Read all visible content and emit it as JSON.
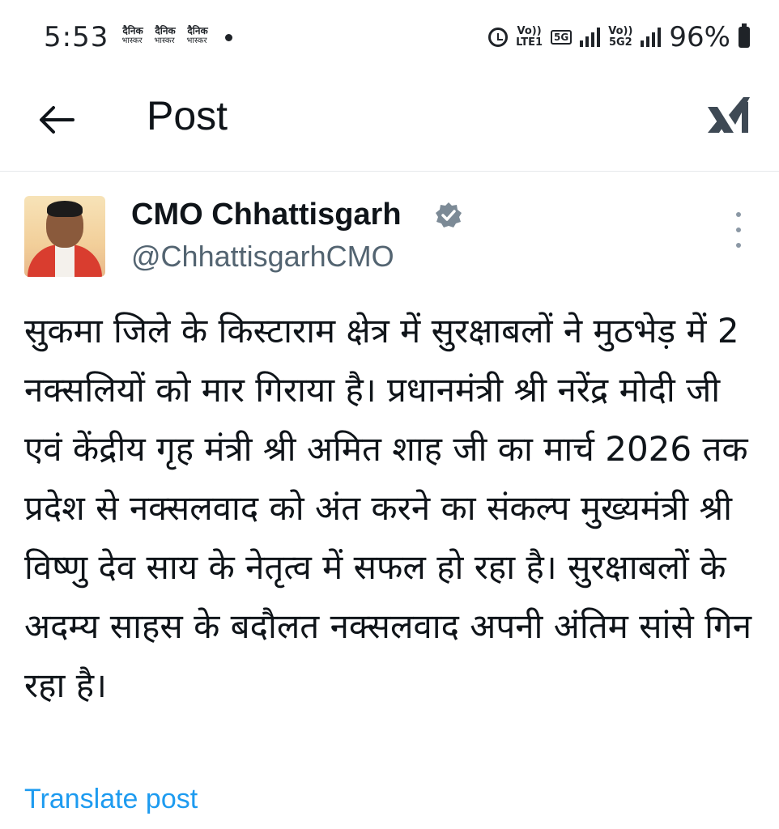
{
  "status_bar": {
    "time": "5:53",
    "notifications": [
      {
        "line1": "दैनिक",
        "line2": "भास्कर"
      },
      {
        "line1": "दैनिक",
        "line2": "भास्कर"
      },
      {
        "line1": "दैनिक",
        "line2": "भास्कर"
      }
    ],
    "sim1": {
      "top": "Vo))",
      "bottom": "LTE1"
    },
    "network_badge": "5G",
    "sim2": {
      "top": "Vo))",
      "bottom": "5G2"
    },
    "battery": "96%"
  },
  "header": {
    "title": "Post",
    "logo": "x-logo"
  },
  "post": {
    "author_name": "CMO Chhattisgarh",
    "handle": "@ChhattisgarhCMO",
    "verified": true,
    "text": "सुकमा जिले के किस्टाराम क्षेत्र में सुरक्षाबलों ने मुठभेड़ में 2 नक्सलियों को मार गिराया है। प्रधानमंत्री श्री नरेंद्र मोदी जी एवं केंद्रीय गृह मंत्री श्री अमित शाह जी का मार्च 2026 तक प्रदेश से नक्सलवाद को अंत करने का संकल्प मुख्यमंत्री श्री विष्णु देव साय के नेतृत्व में सफल हो रहा है। सुरक्षाबलों के अदम्य साहस के बदौलत नक्सलवाद अपनी अंतिम सांसे गिन रहा है।",
    "translate_label": "Translate post"
  },
  "colors": {
    "link": "#1d9bf0",
    "handle": "#536471",
    "text": "#0f1419",
    "verified": "#7c8a96"
  }
}
